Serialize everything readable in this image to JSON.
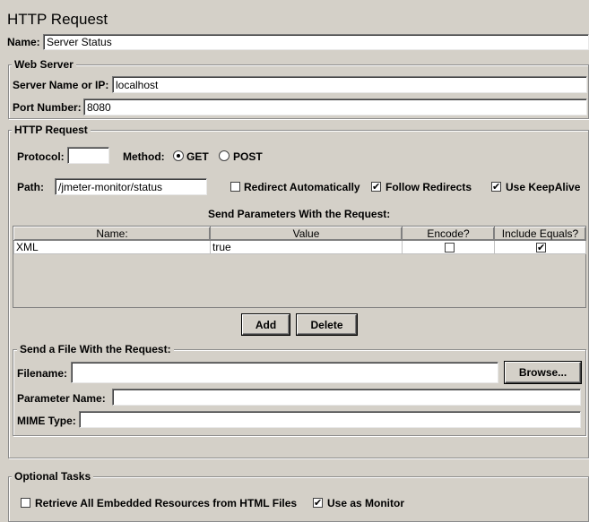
{
  "title": "HTTP Request",
  "name": {
    "label": "Name:",
    "value": "Server Status"
  },
  "web_server": {
    "title": "Web Server",
    "server_label": "Server Name or IP:",
    "server_value": "localhost",
    "port_label": "Port Number:",
    "port_value": "8080"
  },
  "http_request": {
    "title": "HTTP Request",
    "protocol_label": "Protocol:",
    "protocol_value": "",
    "method_label": "Method:",
    "method_get": "GET",
    "method_post": "POST",
    "method_selected": "GET",
    "path_label": "Path:",
    "path_value": "/jmeter-monitor/status",
    "redirect_auto": {
      "label": "Redirect Automatically",
      "checked": false
    },
    "follow_redirects": {
      "label": "Follow Redirects",
      "checked": true
    },
    "keepalive": {
      "label": "Use KeepAlive",
      "checked": true
    },
    "params_title": "Send Parameters With the Request:",
    "params": {
      "columns": [
        "Name:",
        "Value",
        "Encode?",
        "Include Equals?"
      ],
      "rows": [
        {
          "name": "XML",
          "value": "true",
          "encode": false,
          "include_equals": true
        }
      ]
    },
    "add_label": "Add",
    "delete_label": "Delete"
  },
  "file": {
    "title": "Send a File With the Request:",
    "filename_label": "Filename:",
    "filename_value": "",
    "browse_label": "Browse...",
    "param_name_label": "Parameter Name:",
    "param_name_value": "",
    "mime_label": "MIME Type:",
    "mime_value": ""
  },
  "optional": {
    "title": "Optional Tasks",
    "retrieve": {
      "label": "Retrieve All Embedded Resources from HTML Files",
      "checked": false
    },
    "monitor": {
      "label": "Use as Monitor",
      "checked": true
    }
  },
  "checkmark": "✔"
}
